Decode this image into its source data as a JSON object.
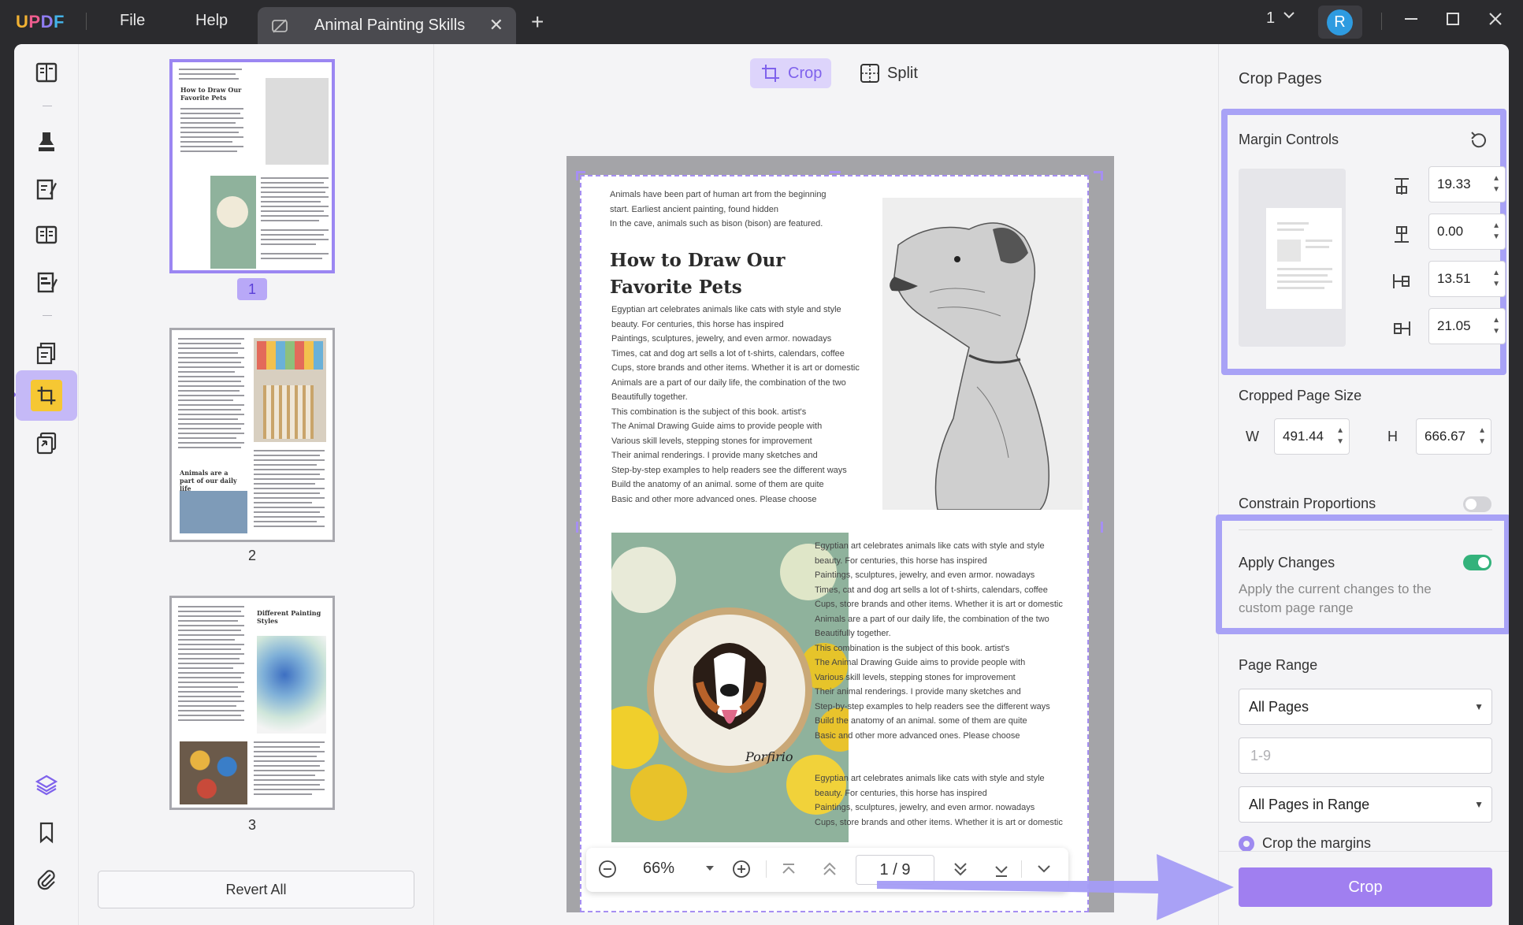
{
  "app": {
    "logo": "UPDF"
  },
  "menu": {
    "file": "File",
    "help": "Help"
  },
  "tab": {
    "title": "Animal Painting Skills",
    "close": "✕"
  },
  "titlebar": {
    "page_count": "1",
    "avatar_letter": "R"
  },
  "thumbnails": {
    "pages": [
      {
        "number": "1",
        "heading": "How to Draw Our Favorite Pets"
      },
      {
        "number": "2",
        "heading": "Animals are a part of our daily life"
      },
      {
        "number": "3",
        "heading": "Different Painting Styles"
      }
    ],
    "revert_label": "Revert All"
  },
  "modes": {
    "crop": "Crop",
    "split": "Split"
  },
  "document": {
    "intro": [
      "Animals have been part of human art from the beginning",
      "start. Earliest ancient painting, found hidden",
      "In the cave, animals such as bison (bison) are featured."
    ],
    "title_line1": "How to Draw Our",
    "title_line2": "Favorite Pets",
    "body_left": [
      "Egyptian art celebrates animals like cats with style and style",
      "beauty. For centuries, this horse has inspired",
      "Paintings, sculptures, jewelry, and even armor. nowadays",
      "Times, cat and dog art sells a lot of t-shirts, calendars, coffee",
      "Cups, store brands and other items. Whether it is art or domestic",
      "Animals are a part of our daily life, the combination of the two",
      "Beautifully together.",
      "This combination is the subject of this book. artist's",
      "The Animal Drawing Guide aims to provide people with",
      "Various skill levels, stepping stones for improvement",
      "Their animal renderings. I provide many sketches and",
      "Step-by-step examples to help readers see the different ways",
      "Build the anatomy of an animal. some of them are quite",
      "Basic and other more advanced ones. Please choose"
    ],
    "body_right": [
      "Egyptian art celebrates animals like cats with style and style",
      "beauty. For centuries, this horse has inspired",
      "Paintings, sculptures, jewelry, and even armor. nowadays",
      "Times, cat and dog art sells a lot of t-shirts, calendars, coffee",
      "Cups, store brands and other items. Whether it is art or domestic",
      "Animals are a part of our daily life, the combination of the two",
      "Beautifully together.",
      "This combination is the subject of this book. artist's",
      "The Animal Drawing Guide aims to provide people with",
      "Various skill levels, stepping stones for improvement",
      "Their animal renderings. I provide many sketches and",
      "Step-by-step examples to help readers see the different ways",
      "Build the anatomy of an animal. some of them are quite",
      "Basic and other more advanced ones. Please choose"
    ],
    "body_right2": [
      "Egyptian art celebrates animals like cats with style and style",
      "beauty. For centuries, this horse has inspired",
      "Paintings, sculptures, jewelry, and even armor. nowadays",
      "Cups, store brands and other items. Whether it is art or domestic"
    ],
    "embroidery_text": "Porfirio"
  },
  "navbar": {
    "zoom": "66%",
    "page_current": "1",
    "page_sep": "/",
    "page_total": "9"
  },
  "panel": {
    "title": "Crop Pages",
    "margin_controls": "Margin Controls",
    "margins": {
      "top": "19.33",
      "bottom": "0.00",
      "left": "13.51",
      "right": "21.05"
    },
    "cropped_size_label": "Cropped Page Size",
    "width_label": "W",
    "width": "491.44",
    "height_label": "H",
    "height": "666.67",
    "constrain_label": "Constrain Proportions",
    "constrain_on": false,
    "apply_label": "Apply Changes",
    "apply_desc_line1": "Apply the current changes to the",
    "apply_desc_line2": "custom page range",
    "apply_on": true,
    "page_range_label": "Page Range",
    "page_range_value": "All Pages",
    "range_placeholder": "1-9",
    "subset_value": "All Pages in Range",
    "radio_label": "Crop the margins",
    "crop_button": "Crop"
  },
  "colors": {
    "accent": "#a07ff0",
    "highlight": "#a8a2f6",
    "toggle_on": "#33b27b"
  }
}
